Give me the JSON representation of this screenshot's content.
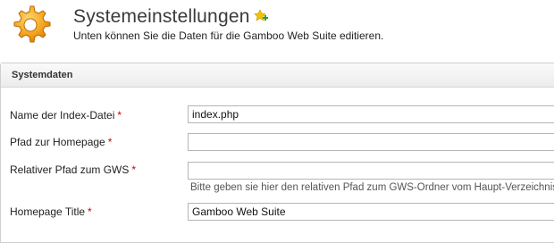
{
  "header": {
    "title": "Systemeinstellungen",
    "subtitle": "Unten können Sie die Daten für die Gamboo Web Suite editieren.",
    "logo_icon": "gear-icon",
    "add_icon": "add-star-icon"
  },
  "panel": {
    "title": "Systemdaten",
    "fields": [
      {
        "label": "Name der Index-Datei",
        "required": "*",
        "value": "index.php",
        "placeholder": ""
      },
      {
        "label": "Pfad zur Homepage",
        "required": "*",
        "value": "",
        "placeholder": ""
      },
      {
        "label": "Relativer Pfad zum GWS",
        "required": "*",
        "value": "",
        "placeholder": "",
        "hint": "Bitte geben sie hier den relativen Pfad zum GWS-Ordner vom Haupt-Verzeichnis"
      },
      {
        "label": "Homepage Title",
        "required": "*",
        "value": "Gamboo Web Suite",
        "placeholder": ""
      }
    ]
  },
  "colors": {
    "required": "#cc0000",
    "gear": "#f5a623",
    "add": "#f2c200"
  }
}
